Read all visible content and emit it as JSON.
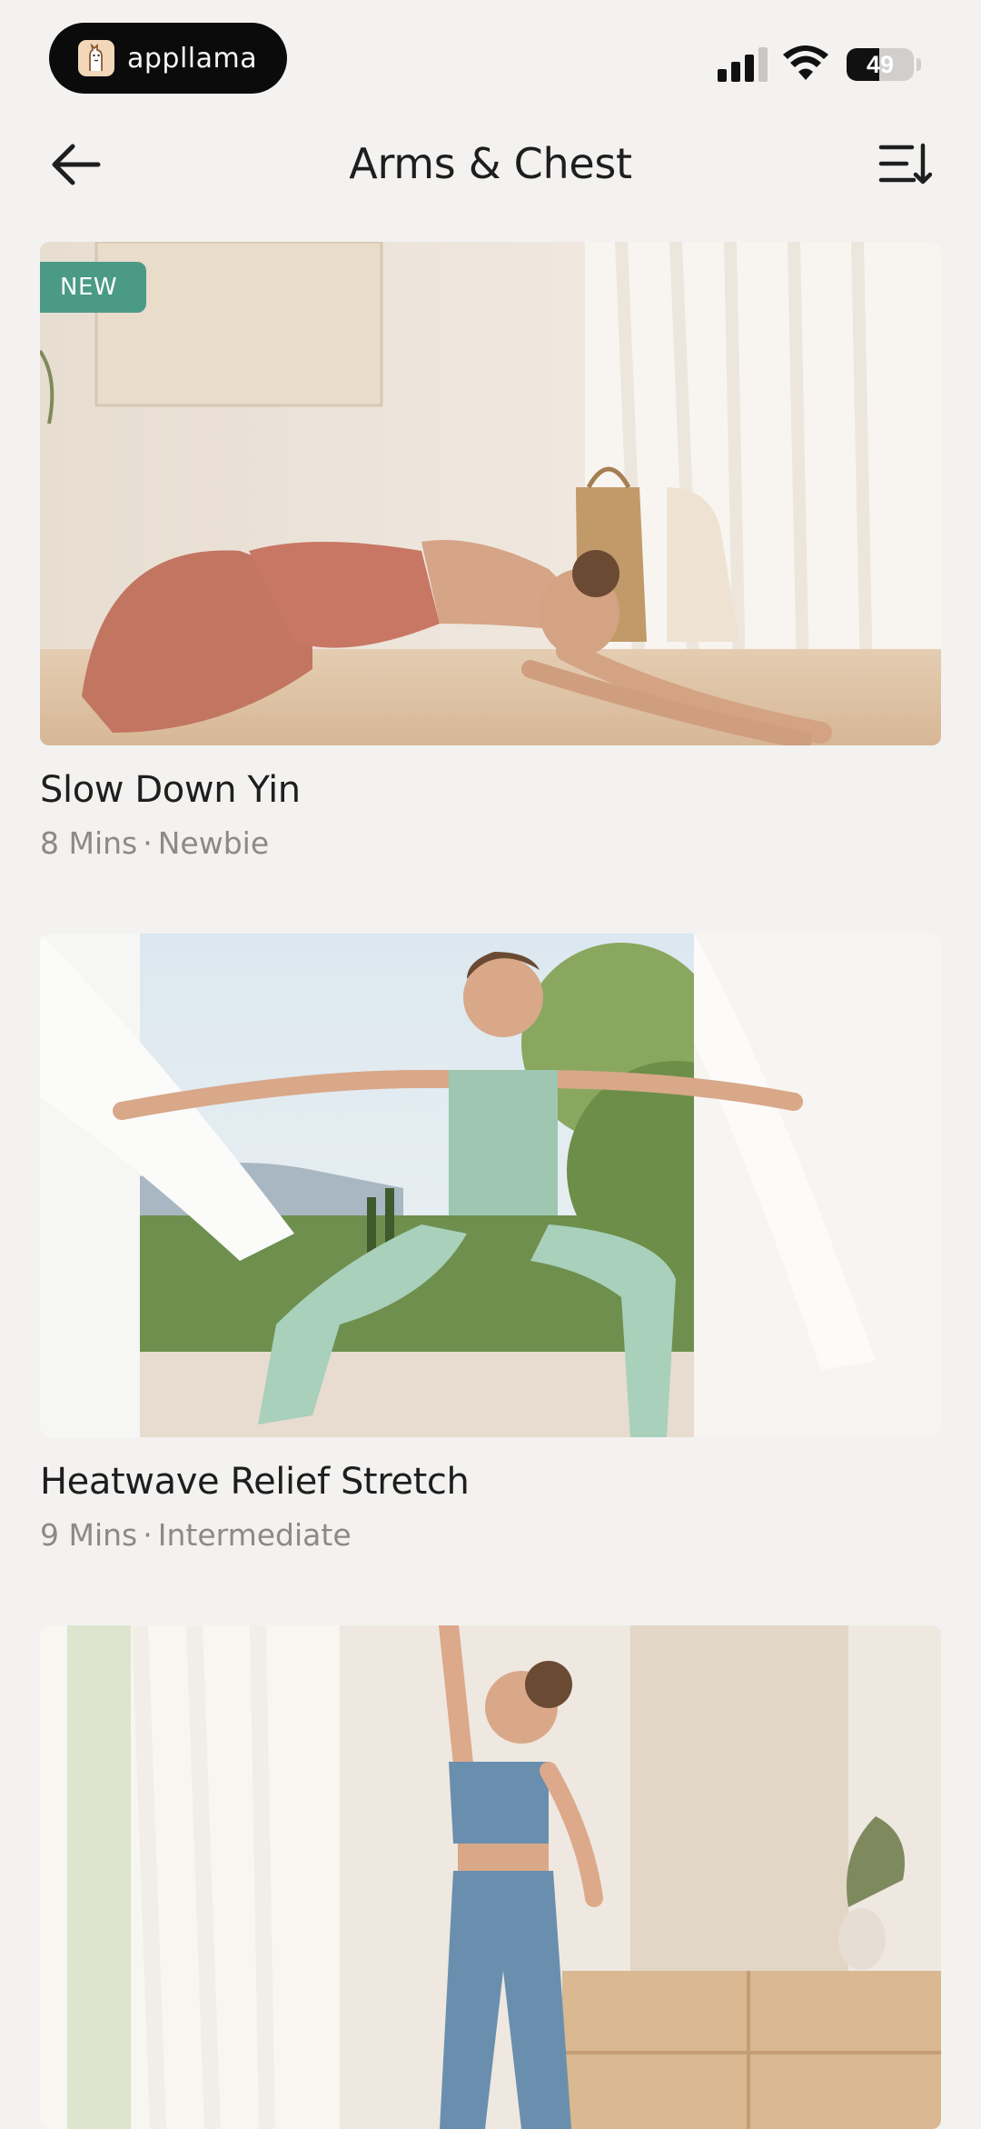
{
  "status_bar": {
    "app_pill_label": "appllama",
    "battery_level": "49",
    "battery_fraction": 0.49,
    "signal_bars_active": 3,
    "signal_bars_total": 4
  },
  "header": {
    "title": "Arms & Chest",
    "back_icon": "arrow-left-icon",
    "sort_icon": "sort-list-icon"
  },
  "workouts": [
    {
      "badge": "NEW",
      "title": "Slow Down Yin",
      "duration": "8 Mins",
      "separator": "·",
      "level": "Newbie",
      "image": "woman-childs-pose-yoga"
    },
    {
      "badge": "",
      "title": "Heatwave Relief Stretch",
      "duration": "9 Mins",
      "separator": "·",
      "level": "Intermediate",
      "image": "woman-lunge-arms-extended"
    },
    {
      "badge": "",
      "title": "",
      "duration": "",
      "separator": "",
      "level": "",
      "image": "woman-standing-arm-raised-stretch"
    }
  ],
  "colors": {
    "background": "#F3F2F0",
    "badge": "#4B9A86",
    "meta_text": "#8C8A87",
    "title_text": "#1E1E1E"
  }
}
